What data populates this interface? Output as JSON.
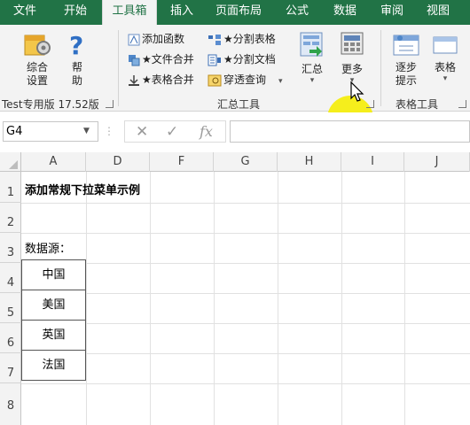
{
  "tabs": [
    "文件",
    "开始",
    "工具箱",
    "插入",
    "页面布局",
    "公式",
    "数据",
    "审阅",
    "视图"
  ],
  "active_tab": "工具箱",
  "ribbon": {
    "settings_btn": "综合\n设置",
    "settings_l1": "综合",
    "settings_l2": "设置",
    "help_l1": "帮",
    "help_l2": "助",
    "version_label": "Test专用版 17.52版",
    "add_function": "添加函数",
    "split_table": "★分割表格",
    "file_merge": "★文件合并",
    "split_doc": "★分割文档",
    "table_merge": "★表格合并",
    "pivot_query": "穿透查询",
    "summary": "汇总",
    "more": "更多",
    "summary_group_label": "汇总工具",
    "step_l1": "逐步",
    "step_l2": "提示",
    "table_btn": "表格",
    "table_tools_label": "表格工具"
  },
  "formula_bar": {
    "name_box": "G4",
    "formula": ""
  },
  "columns": [
    "A",
    "D",
    "F",
    "G",
    "H",
    "I",
    "J"
  ],
  "rows": [
    "1",
    "2",
    "3",
    "4",
    "5",
    "6",
    "7",
    "8"
  ],
  "cells": {
    "title": "添加常规下拉菜单示例",
    "source_label": "数据源：",
    "list": [
      "中国",
      "美国",
      "英国",
      "法国"
    ]
  },
  "colors": {
    "ribbon_green": "#217346",
    "cursor_highlight": "#f5ee1c"
  }
}
